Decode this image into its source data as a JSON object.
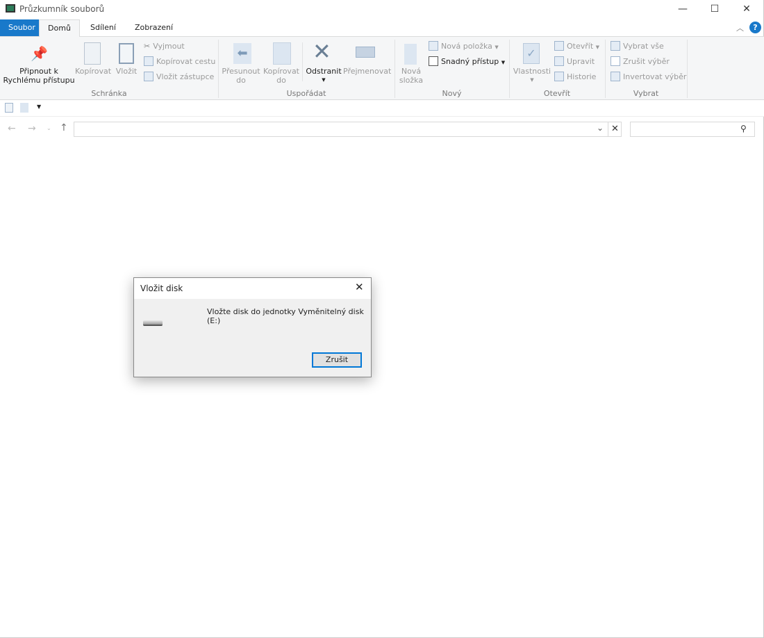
{
  "window": {
    "title": "Průzkumník souborů",
    "minimize": "—",
    "maximize": "☐",
    "close": "✕"
  },
  "tabs": [
    {
      "label": "Soubor"
    },
    {
      "label": "Domů"
    },
    {
      "label": "Sdílení"
    },
    {
      "label": "Zobrazení"
    }
  ],
  "ribbon": {
    "schranka": {
      "group": "Schránka",
      "pin_line1": "Připnout k",
      "pin_line2": "Rychlému přístupu",
      "copy": "Kopírovat",
      "paste": "Vložit",
      "cut": "Vyjmout",
      "copy_path": "Kopírovat cestu",
      "paste_shortcut": "Vložit zástupce"
    },
    "usporadat": {
      "group": "Uspořádat",
      "move_line1": "Přesunout",
      "move_line2": "do",
      "copyto_line1": "Kopírovat",
      "copyto_line2": "do",
      "delete": "Odstranit",
      "rename": "Přejmenovat"
    },
    "novy": {
      "group": "Nový",
      "new_folder_line1": "Nová",
      "new_folder_line2": "složka",
      "new_item": "Nová položka",
      "easy_access": "Snadný přístup"
    },
    "otevrit": {
      "group": "Otevřít",
      "properties": "Vlastnosti",
      "open": "Otevřít",
      "edit": "Upravit",
      "history": "Historie"
    },
    "vybrat": {
      "group": "Vybrat",
      "select_all": "Vybrat vše",
      "select_none": "Zrušit výběr",
      "invert": "Invertovat výběr"
    }
  },
  "address": {
    "value": "",
    "search_value": ""
  },
  "dialog": {
    "title": "Vložit disk",
    "message": "Vložte disk do jednotky Vyměnitelný disk (E:)",
    "cancel": "Zrušit"
  }
}
